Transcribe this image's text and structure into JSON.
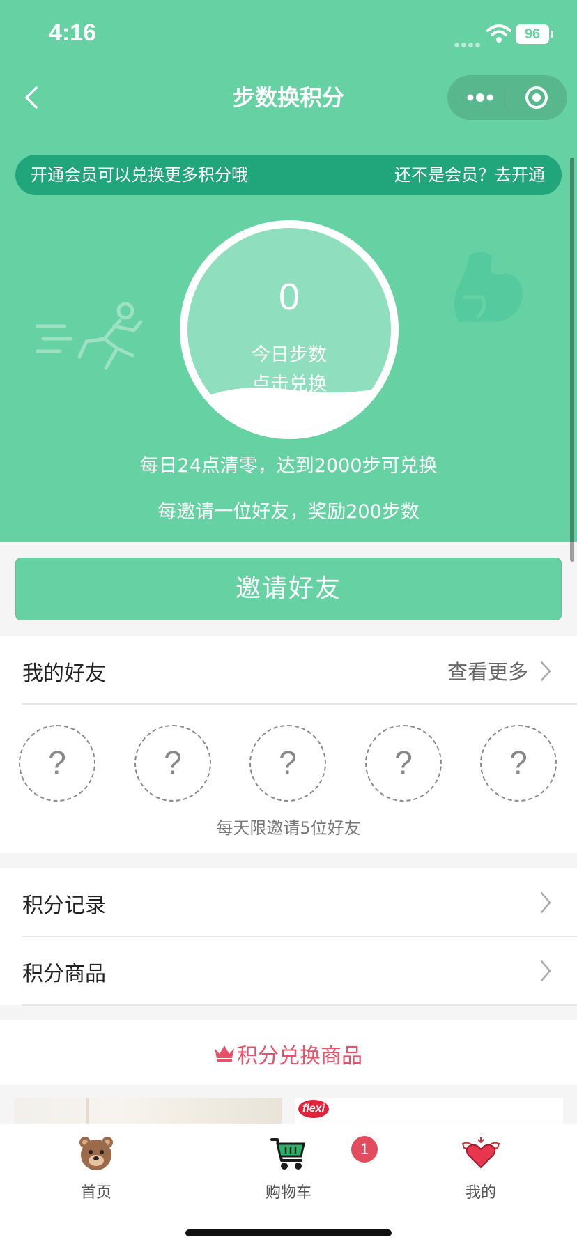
{
  "status_bar": {
    "time": "4:16",
    "battery": "96"
  },
  "nav": {
    "title": "步数换积分"
  },
  "member_banner": {
    "text": "开通会员可以兑换更多积分哦",
    "link": "还不是会员？去开通"
  },
  "steps": {
    "count": "0",
    "label": "今日步数",
    "action": "点击兑换"
  },
  "rules": {
    "line1": "每日24点清零，达到2000步可兑换",
    "line2": "每邀请一位好友，奖励200步数"
  },
  "invite_button": "邀请好友",
  "friends": {
    "title": "我的好友",
    "more": "查看更多",
    "slots": [
      "?",
      "?",
      "?",
      "?",
      "?"
    ],
    "limit_text": "每天限邀请5位好友"
  },
  "menu": [
    {
      "label": "积分记录"
    },
    {
      "label": "积分商品"
    }
  ],
  "section": {
    "title": "积分兑换商品"
  },
  "products": {
    "right_brand": "flexi"
  },
  "tabbar": {
    "items": [
      {
        "label": "首页",
        "icon": "bear-icon"
      },
      {
        "label": "购物车",
        "icon": "cart-icon"
      },
      {
        "label": "我的",
        "icon": "winged-heart-icon"
      }
    ],
    "cart_badge": "1"
  },
  "colors": {
    "primary": "#66d1a2",
    "banner": "#21a57a",
    "accent_red": "#e8516a",
    "badge": "#e34b5f"
  }
}
